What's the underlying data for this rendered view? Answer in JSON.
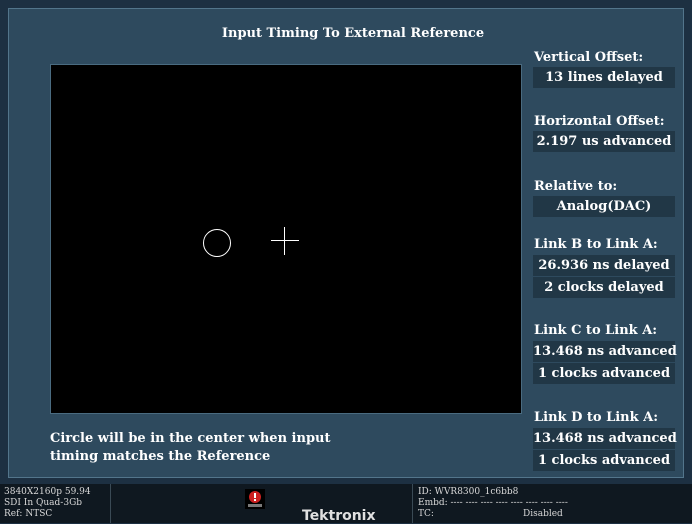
{
  "title": "Input Timing To External Reference",
  "caption_line1": "Circle will be in the center when input",
  "caption_line2": "timing matches the Reference",
  "readouts": {
    "vertical_offset_label": "Vertical Offset:",
    "vertical_offset_value": "13 lines delayed",
    "horizontal_offset_label": "Horizontal Offset:",
    "horizontal_offset_value": "2.197 us advanced",
    "relative_to_label": "Relative to:",
    "relative_to_value": "Analog(DAC)",
    "link_b_label": "Link B to Link A:",
    "link_b_ns": "26.936 ns delayed",
    "link_b_clocks": "2 clocks delayed",
    "link_c_label": "Link C to Link A:",
    "link_c_ns": "13.468 ns advanced",
    "link_c_clocks": "1 clocks advanced",
    "link_d_label": "Link D to Link A:",
    "link_d_ns": "13.468 ns advanced",
    "link_d_clocks": "1 clocks advanced"
  },
  "status": {
    "format": "3840X2160p 59.94",
    "input": "SDI In Quad-3Gb",
    "ref": "Ref: NTSC",
    "id": "ID: WVR8300_1c6bb8",
    "embd": "Embd: ---- ---- ---- ---- ---- ---- ---- ----",
    "tc_label": "TC:",
    "tc_value": "Disabled",
    "brand": "Tektronix"
  },
  "colors": {
    "background": "#1d3042",
    "panel": "#2e4a5e",
    "value_box": "#213746",
    "alarm": "#cc2020"
  },
  "icons": [
    "alarm-icon",
    "target-circle-icon",
    "crosshair-icon"
  ]
}
